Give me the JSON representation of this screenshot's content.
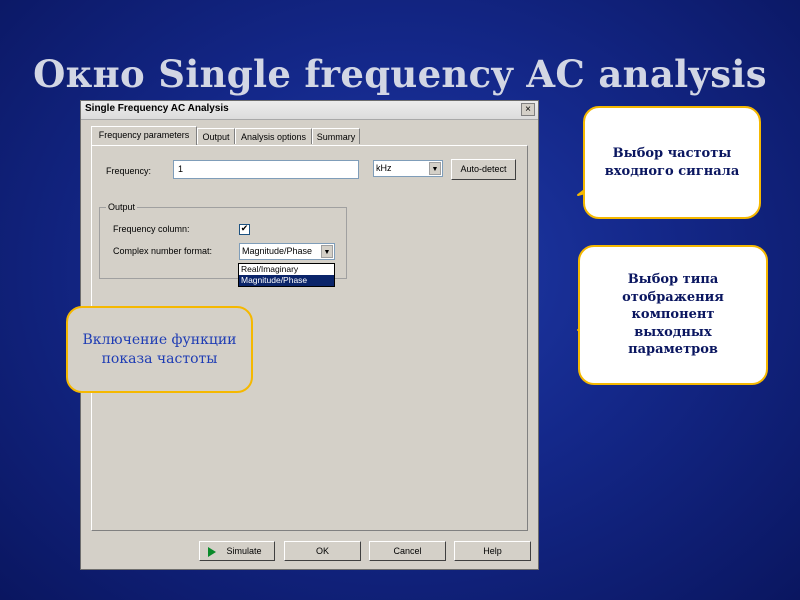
{
  "slide": {
    "title": "Окно Single frequency AC analysis"
  },
  "dialog": {
    "title": "Single Frequency AC Analysis",
    "close_glyph": "×",
    "tabs": [
      {
        "label": "Frequency parameters",
        "active": true
      },
      {
        "label": "Output",
        "active": false
      },
      {
        "label": "Analysis options",
        "active": false
      },
      {
        "label": "Summary",
        "active": false
      }
    ],
    "frequency": {
      "label": "Frequency:",
      "value": "1",
      "unit": "kHz",
      "auto_detect_label": "Auto-detect"
    },
    "output_group": {
      "title": "Output",
      "frequency_column_label": "Frequency column:",
      "frequency_column_checked": true,
      "check_glyph": "✔",
      "complex_format_label": "Complex number format:",
      "complex_format_value": "Magnitude/Phase",
      "dropdown_arrow": "▼",
      "options": [
        "Real/Imaginary",
        "Magnitude/Phase"
      ],
      "selected_option_index": 1
    },
    "buttons": {
      "simulate": "Simulate",
      "ok": "OK",
      "cancel": "Cancel",
      "help": "Help"
    }
  },
  "callouts": {
    "frequency_select": "Выбор частоты входного сигнала",
    "display_type": "Выбор типа отображения компонент выходных параметров",
    "frequency_show": "Включение функции показа частоты"
  },
  "colors": {
    "background": "#14288a",
    "callout_border": "#f5b800",
    "selection": "#0a246a"
  }
}
